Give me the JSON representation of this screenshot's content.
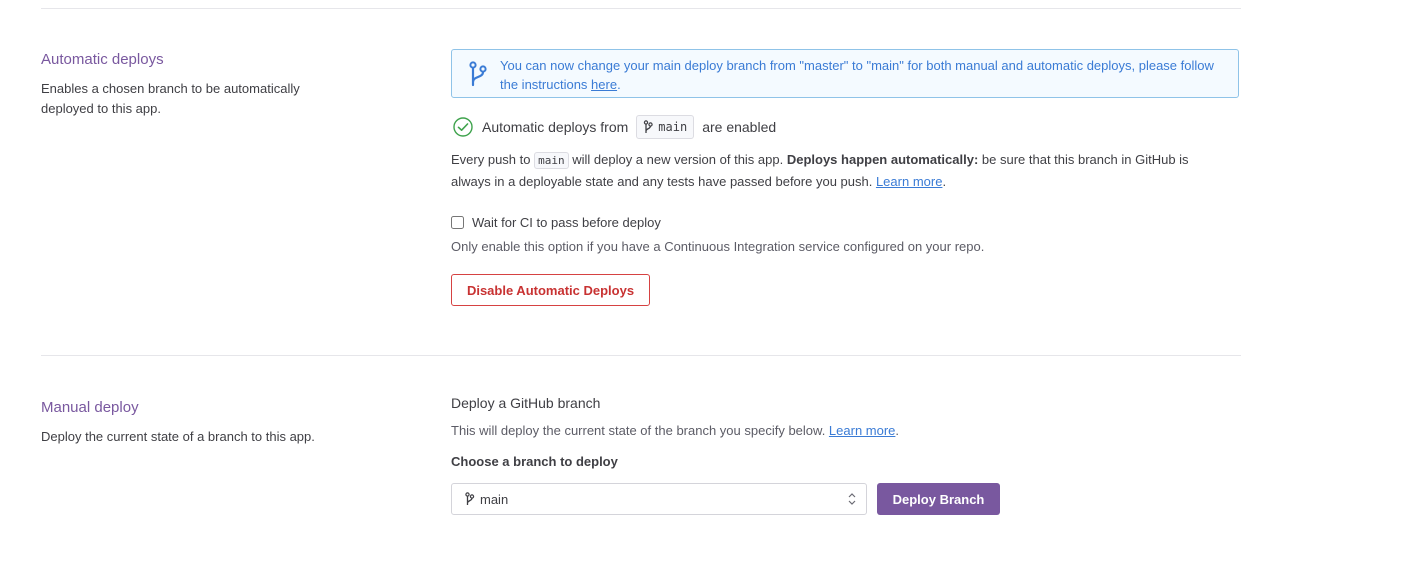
{
  "automatic_deploys": {
    "title": "Automatic deploys",
    "description": "Enables a chosen branch to be automatically deployed to this app.",
    "notice": {
      "text": "You can now change your main deploy branch from \"master\" to \"main\" for both manual and automatic deploys, please follow the instructions ",
      "link_label": "here",
      "suffix": "."
    },
    "status": {
      "prefix": "Automatic deploys from",
      "branch": "main",
      "suffix": "are enabled"
    },
    "info": {
      "part1": "Every push to ",
      "branch": "main",
      "part2": " will deploy a new version of this app. ",
      "emphasis": "Deploys happen automatically:",
      "part3": " be sure that this branch in GitHub is always in a deployable state and any tests have passed before you push. ",
      "learn_more": "Learn more",
      "end": "."
    },
    "ci_checkbox": {
      "label": "Wait for CI to pass before deploy",
      "checked": false,
      "help": "Only enable this option if you have a Continuous Integration service configured on your repo."
    },
    "disable_button": "Disable Automatic Deploys"
  },
  "manual_deploy": {
    "title": "Manual deploy",
    "description": "Deploy the current state of a branch to this app.",
    "heading": "Deploy a GitHub branch",
    "info": "This will deploy the current state of the branch you specify below. ",
    "learn_more": "Learn more",
    "end": ".",
    "choose_label": "Choose a branch to deploy",
    "selected_branch": "main",
    "deploy_button": "Deploy Branch"
  },
  "colors": {
    "accent": "#79589f",
    "link": "#3a7bd5",
    "danger": "#c83232",
    "success": "#3fa34d"
  }
}
